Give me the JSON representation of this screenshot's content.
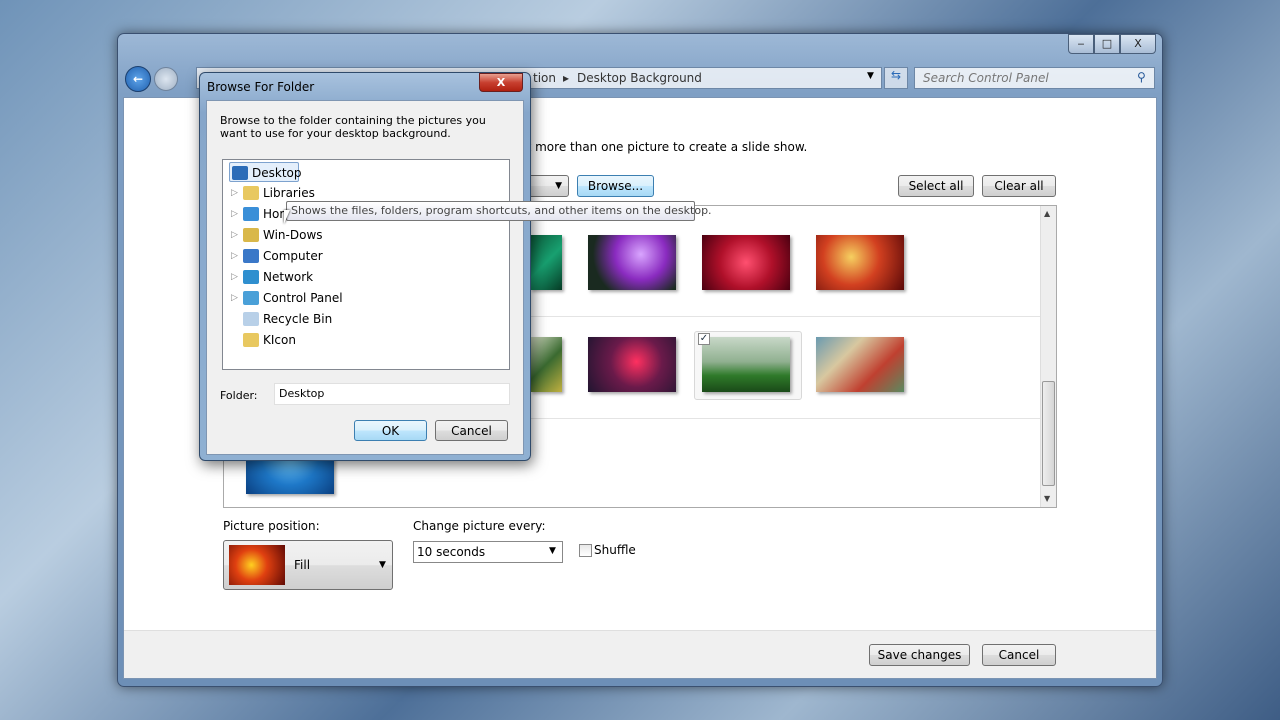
{
  "window": {
    "minimize": "‒",
    "maximize": "□",
    "close": "X",
    "breadcrumb_partial": "tion",
    "breadcrumb_current": "Desktop Background",
    "search_placeholder": "Search Control Panel"
  },
  "main": {
    "instruction_partial": "ct more than one picture to create a slide show.",
    "browse_label": "Browse...",
    "select_all_label": "Select all",
    "clear_all_label": "Clear all",
    "picture_position_label": "Picture position:",
    "picture_position_value": "Fill",
    "change_picture_label": "Change picture every:",
    "change_picture_value": "10 seconds",
    "shuffle_label": "Shuffle",
    "shuffle_checked": false,
    "save_label": "Save changes",
    "cancel_label": "Cancel",
    "thumbnails_selected": "checked"
  },
  "dialog": {
    "title": "Browse For Folder",
    "close": "X",
    "instructions": "Browse to the folder containing the pictures you want to use for your desktop background.",
    "tree": [
      {
        "label": "Desktop",
        "icon": "desktop-icon",
        "expandable": false,
        "selected": true,
        "color": "#2b6cb8"
      },
      {
        "label": "Libraries",
        "icon": "libraries-icon",
        "expandable": true,
        "color": "#e8c860"
      },
      {
        "label": "Hom",
        "icon": "homegroup-icon",
        "expandable": true,
        "color": "#3a8fd8"
      },
      {
        "label": "Win-Dows",
        "icon": "user-folder-icon",
        "expandable": true,
        "color": "#d9b84a"
      },
      {
        "label": "Computer",
        "icon": "computer-icon",
        "expandable": true,
        "color": "#3a78c8"
      },
      {
        "label": "Network",
        "icon": "network-icon",
        "expandable": true,
        "color": "#2f8fcf"
      },
      {
        "label": "Control Panel",
        "icon": "control-panel-icon",
        "expandable": true,
        "color": "#4aa0d8"
      },
      {
        "label": "Recycle Bin",
        "icon": "recycle-bin-icon",
        "expandable": false,
        "color": "#b8d0e8"
      },
      {
        "label": "KIcon",
        "icon": "folder-icon",
        "expandable": false,
        "color": "#e8c860"
      }
    ],
    "tooltip": "Shows the files, folders, program shortcuts, and other items on the desktop.",
    "folder_label": "Folder:",
    "folder_value": "Desktop",
    "ok_label": "OK",
    "cancel_label": "Cancel"
  }
}
